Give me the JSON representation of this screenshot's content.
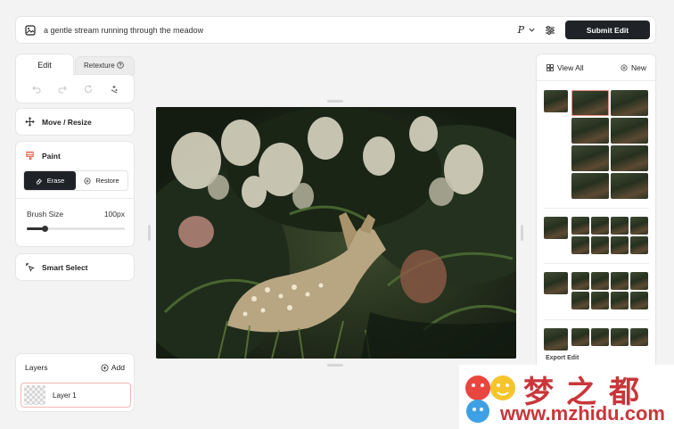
{
  "topbar": {
    "prompt": "a gentle stream running through the meadow",
    "model_icon": "P",
    "submit_label": "Submit Edit"
  },
  "tools": {
    "tab_edit": "Edit",
    "tab_retexture": "Retexture"
  },
  "move": {
    "label": "Move / Resize"
  },
  "paint": {
    "label": "Paint",
    "erase_label": "Erase",
    "restore_label": "Restore",
    "brush_size_label": "Brush Size",
    "brush_size_value": "100px",
    "brush_level_fraction": 0.19
  },
  "smart_select": {
    "label": "Smart Select"
  },
  "layers": {
    "title": "Layers",
    "add_label": "Add",
    "items": [
      {
        "name": "Layer 1"
      }
    ]
  },
  "history": {
    "view_all_label": "View All",
    "new_label": "New",
    "export_label": "Export Edit"
  },
  "watermark": {
    "chinese": "梦之都",
    "url": "www.mzhidu.com"
  },
  "colors": {
    "accent_dark": "#1f2226",
    "selection_outline": "#ef8b80",
    "watermark_red": "#c9363a"
  }
}
